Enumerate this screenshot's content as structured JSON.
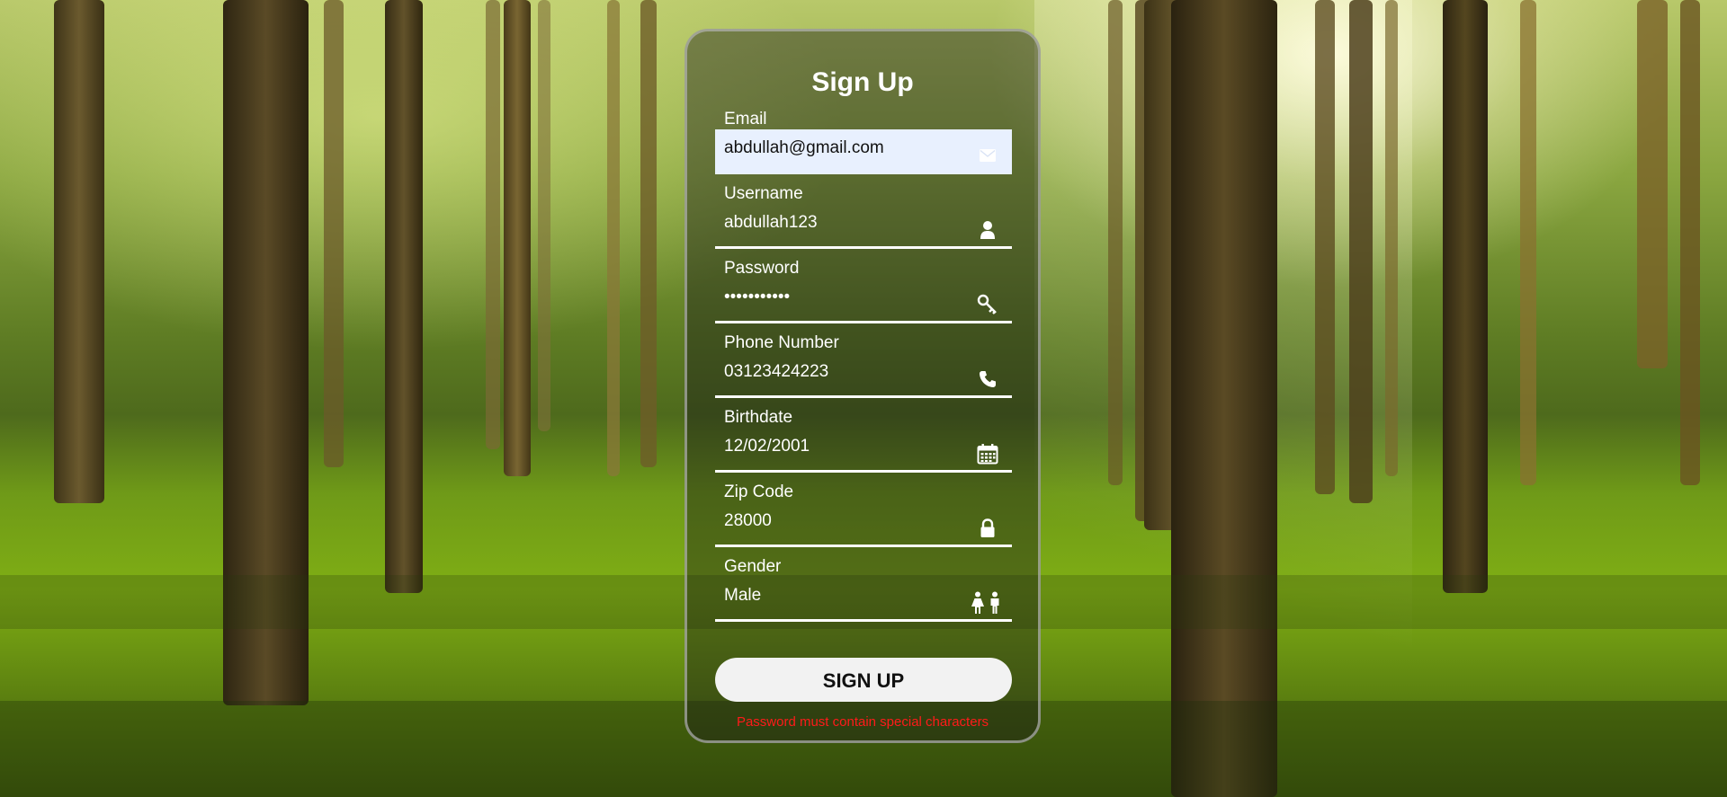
{
  "form": {
    "title": "Sign Up",
    "fields": [
      {
        "label": "Email",
        "value": "abdullah@gmail.com",
        "icon": "envelope-icon"
      },
      {
        "label": "Username",
        "value": "abdullah123",
        "icon": "user-icon"
      },
      {
        "label": "Password",
        "value": "•••••••••••",
        "icon": "key-icon"
      },
      {
        "label": "Phone Number",
        "value": "03123424223",
        "icon": "phone-icon"
      },
      {
        "label": "Birthdate",
        "value": "12/02/2001",
        "icon": "calendar-icon"
      },
      {
        "label": "Zip Code",
        "value": "28000",
        "icon": "lock-icon"
      },
      {
        "label": "Gender",
        "value": "Male",
        "icon": "gender-icon"
      }
    ],
    "submit_label": "SIGN UP",
    "error_message": "Password must contain special characters"
  },
  "colors": {
    "error": "#ff1a1a",
    "autofill_background": "#e8f0fe"
  }
}
